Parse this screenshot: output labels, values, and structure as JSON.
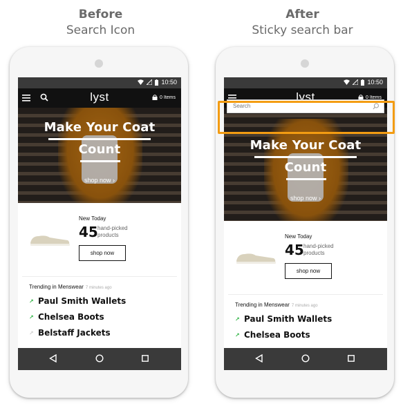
{
  "captions": {
    "before": {
      "heading": "Before",
      "subheading": "Search Icon"
    },
    "after": {
      "heading": "After",
      "subheading": "Sticky search bar"
    }
  },
  "status": {
    "time": "10:50"
  },
  "app": {
    "logo": "lyst",
    "cart_label": "0 Items"
  },
  "sticky_search": {
    "placeholder": "Search"
  },
  "hero": {
    "line1": "Make Your Coat",
    "line2": "Count",
    "cta": "shop now ›"
  },
  "new_today": {
    "label": "New Today",
    "count": "45",
    "desc": "hand-picked products",
    "button": "shop now"
  },
  "trending": {
    "heading": "Trending in Menswear",
    "ago": "7 minutes ago",
    "items": [
      {
        "label": "Paul Smith Wallets",
        "arrow": "↗"
      },
      {
        "label": "Chelsea Boots",
        "arrow": "↗"
      },
      {
        "label": "Belstaff Jackets",
        "arrow": "↗"
      }
    ]
  },
  "colors": {
    "highlight": "#f39c12",
    "appbar": "#111111",
    "navbar": "#3a3a3a",
    "trend_arrow": "#2fb344"
  },
  "icons": [
    "menu-icon",
    "search-icon",
    "shopping-bag-icon",
    "wifi-icon",
    "signal-icon",
    "battery-icon",
    "back-icon",
    "home-icon",
    "recent-apps-icon"
  ]
}
